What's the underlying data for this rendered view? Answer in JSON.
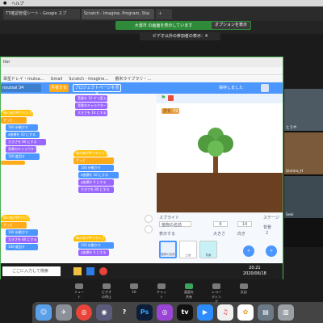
{
  "macmenu": {
    "help": "ヘルプ"
  },
  "host_tabs": [
    {
      "label": "TT確認管理シート - Google スプ"
    },
    {
      "label": "Scratch - Imagine, Program, Sha"
    },
    {
      "label": ""
    }
  ],
  "zoom_notice": {
    "sharing": "大濱市 の画面を表示しています",
    "options": "オプションを表示",
    "viewing": "ビデオ以外の参加者の表示：4"
  },
  "inner": {
    "title": "itor",
    "bookmarks": [
      "翠星ドレイ・mutsa…",
      "Gmail",
      "Scratch - Imagine…",
      "番米ライブラリ・…"
    ],
    "menu": {
      "project": "noutsal 34",
      "share": "共有する",
      "project_page": "プロジェクトページを見る",
      "save": "保存しました",
      "user": "ryo"
    },
    "sprite_label": {
      "name": "変化",
      "value": "79"
    }
  },
  "sprite_panel": {
    "label": "スプライト",
    "name": "植物の名前",
    "x": "6",
    "y": "14",
    "show": "表示する",
    "size": "大きさ",
    "direction": "向き",
    "stage": "ステージ",
    "backdrops": "背景",
    "backdrop_count": "2",
    "thumbs": [
      "植物の名前",
      "土台",
      "背景"
    ]
  },
  "code_blocks": [
    "音量を 10 ずつ変える",
    "背景のキャラクター",
    "大きさを 10 にする",
    "緑の旗が押されたとき",
    "ずっと",
    "100 歩動かす",
    "x座標を 10 にする",
    "y座標を 0 にする",
    "大きさを 80 にする",
    "100 度回す"
  ],
  "taskbar": {
    "search": "ここに入力して検索",
    "time": "20:21",
    "date": "2020/06/18"
  },
  "participants": [
    {
      "name": "とうや"
    },
    {
      "name": "Uichiro_H"
    },
    {
      "name": "Seki"
    }
  ],
  "zoom_controls": [
    "ミュート",
    "ビデオの停止",
    "参加者",
    "チャット",
    "画面を共有",
    "レコーディング",
    "反応",
    "退出"
  ],
  "zoom_badge": "10",
  "dock_apps": [
    "Finder",
    "Launchpad",
    "Chrome",
    "Siri",
    "Help",
    "Photoshop",
    "Podcasts",
    "TV",
    "Zoom",
    "Music",
    "Photos",
    "Preview",
    "Trash"
  ],
  "colors": {
    "scratch_blue": "#4c97ff",
    "events": "#ffbf00",
    "control": "#ffab19",
    "looks": "#9966ff",
    "share_green": "#2f8a3a"
  }
}
